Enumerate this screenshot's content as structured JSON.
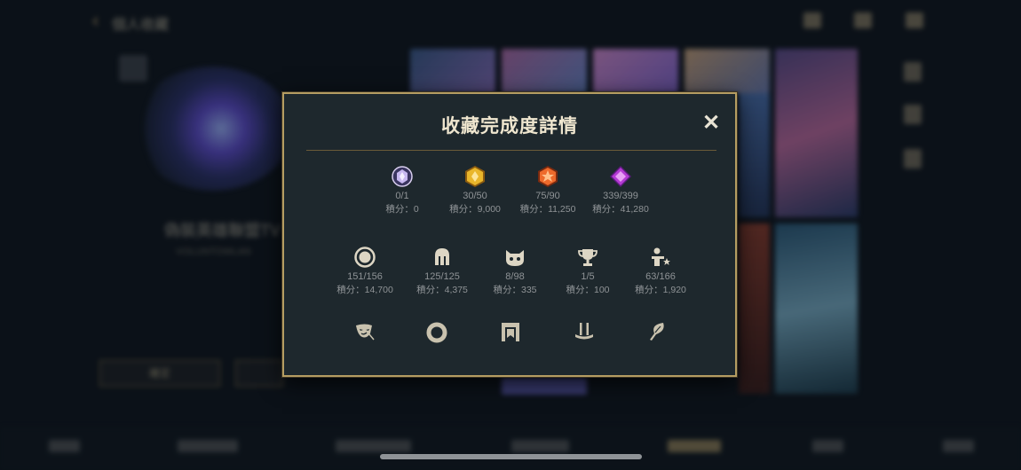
{
  "background": {
    "header_title": "個人收藏",
    "profile_name": "偽裝英雄聯盟TV 極",
    "profile_sub": "VOLUNTOWLAN",
    "button_left": "確定",
    "bottom_tabs": [
      "英雄",
      "造型收藏",
      "召喚師圖示",
      "表情符號",
      "收藏完成",
      "守護者",
      "其他"
    ]
  },
  "modal": {
    "title": "收藏完成度詳情",
    "close_glyph": "✕",
    "rarity_stats": [
      {
        "icon": "ultimate-rarity-gem-icon",
        "color": "#b9a6ef",
        "count": "0/1",
        "score": "積分：0"
      },
      {
        "icon": "mythic-rarity-gem-icon",
        "color": "#e9b62b",
        "count": "30/50",
        "score": "積分：9,000"
      },
      {
        "icon": "legendary-rarity-gem-icon",
        "color": "#ee6a2b",
        "count": "75/90",
        "score": "積分：11,250"
      },
      {
        "icon": "epic-rarity-gem-icon",
        "color": "#b43ad3",
        "count": "339/399",
        "score": "積分：41,280"
      }
    ],
    "collection_stats": [
      {
        "icon": "ring-icon",
        "count": "151/156",
        "score": "積分：14,700"
      },
      {
        "icon": "helmet-icon",
        "count": "125/125",
        "score": "積分：4,375"
      },
      {
        "icon": "poro-icon",
        "count": "8/98",
        "score": "積分：335"
      },
      {
        "icon": "trophy-icon",
        "count": "1/5",
        "score": "積分：100"
      },
      {
        "icon": "person-star-icon",
        "count": "63/166",
        "score": "積分：1,920"
      }
    ],
    "extra_icons": [
      "mask-icon",
      "donut-icon",
      "banner-icon",
      "pedestal-icon",
      "feather-icon"
    ],
    "accent_color": "#b59d62"
  }
}
